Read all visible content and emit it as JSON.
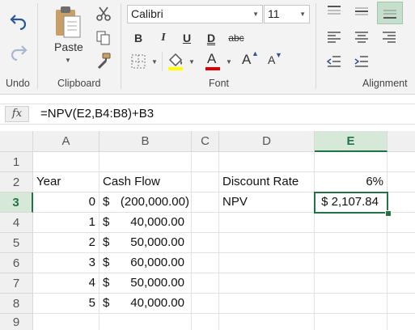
{
  "ribbon": {
    "undo_label": "Undo",
    "paste_label": "Paste",
    "clipboard_label": "Clipboard",
    "font_group_label": "Font",
    "alignment_label": "Alignment",
    "font_name": "Calibri",
    "font_size": "11",
    "bold": "B",
    "italic": "I",
    "underline": "U",
    "double_underline": "D",
    "strikethrough": "abc",
    "font_color": "A",
    "grow_font": "A",
    "shrink_font": "A"
  },
  "formula_bar": {
    "fx_label": "fx",
    "formula": "=NPV(E2,B4:B8)+B3"
  },
  "columns": [
    "A",
    "B",
    "C",
    "D",
    "E"
  ],
  "selected_column": "E",
  "rows": [
    "1",
    "2",
    "3",
    "4",
    "5",
    "6",
    "7",
    "8",
    "9"
  ],
  "selected_row": "3",
  "cells": {
    "A2": "Year",
    "B2": "Cash Flow",
    "D2": "Discount Rate",
    "E2": "6%",
    "A3": "0",
    "B3_sym": "$",
    "B3_val": "(200,000.00)",
    "D3": "NPV",
    "E3": "$ 2,107.84",
    "A4": "1",
    "B4_sym": "$",
    "B4_val": "40,000.00",
    "A5": "2",
    "B5_sym": "$",
    "B5_val": "50,000.00",
    "A6": "3",
    "B6_sym": "$",
    "B6_val": "60,000.00",
    "A7": "4",
    "B7_sym": "$",
    "B7_val": "50,000.00",
    "A8": "5",
    "B8_sym": "$",
    "B8_val": "40,000.00"
  },
  "colors": {
    "excel_green": "#217346",
    "font_color_bar": "#e00000",
    "highlight_bar": "#ffff00"
  }
}
